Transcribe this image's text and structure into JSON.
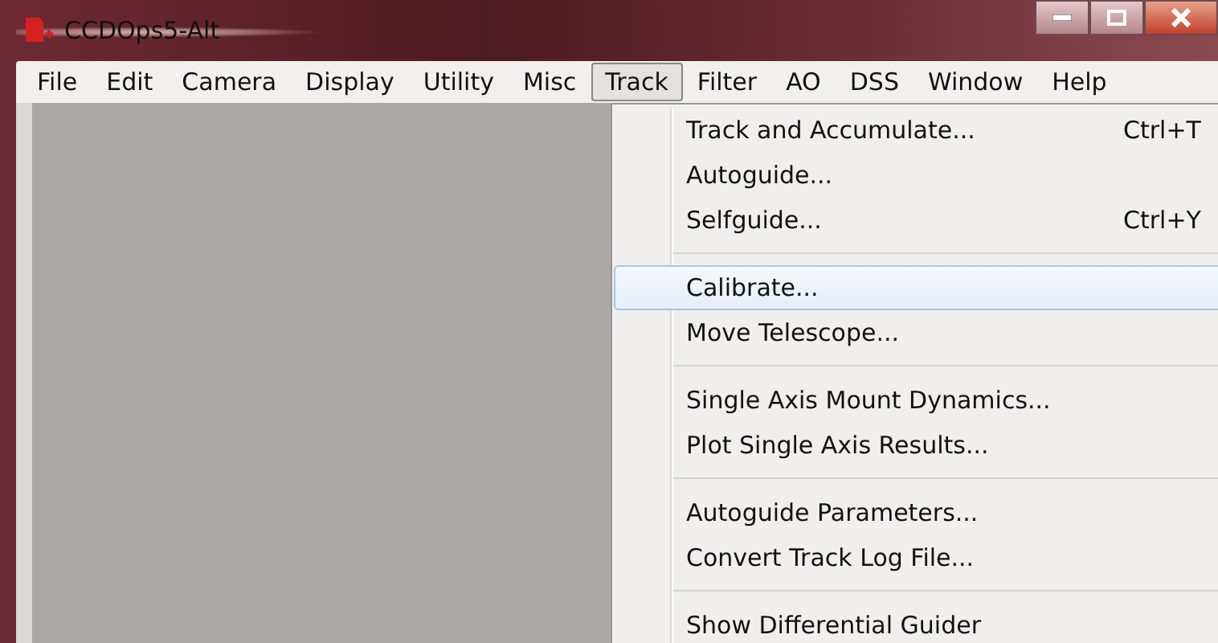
{
  "window": {
    "title": "CCDOps5-Alt"
  },
  "menu_bar": [
    {
      "label": "File",
      "selected": false
    },
    {
      "label": "Edit",
      "selected": false
    },
    {
      "label": "Camera",
      "selected": false
    },
    {
      "label": "Display",
      "selected": false
    },
    {
      "label": "Utility",
      "selected": false
    },
    {
      "label": "Misc",
      "selected": false
    },
    {
      "label": "Track",
      "selected": true
    },
    {
      "label": "Filter",
      "selected": false
    },
    {
      "label": "AO",
      "selected": false
    },
    {
      "label": "DSS",
      "selected": false
    },
    {
      "label": "Window",
      "selected": false
    },
    {
      "label": "Help",
      "selected": false
    }
  ],
  "menu": {
    "items": [
      {
        "kind": "item",
        "label": "Track and Accumulate...",
        "shortcut": "Ctrl+T",
        "selected": false
      },
      {
        "kind": "item",
        "label": "Autoguide...",
        "selected": false
      },
      {
        "kind": "item",
        "label": "Selfguide...",
        "shortcut": "Ctrl+Y",
        "selected": false
      },
      {
        "kind": "separator"
      },
      {
        "kind": "item",
        "label": "Calibrate...",
        "selected": true
      },
      {
        "kind": "item",
        "label": "Move Telescope...",
        "selected": false
      },
      {
        "kind": "separator"
      },
      {
        "kind": "item",
        "label": "Single Axis Mount Dynamics...",
        "selected": false
      },
      {
        "kind": "item",
        "label": "Plot Single Axis Results...",
        "selected": false
      },
      {
        "kind": "separator"
      },
      {
        "kind": "item",
        "label": "Autoguide Parameters...",
        "selected": false
      },
      {
        "kind": "item",
        "label": "Convert Track Log File...",
        "selected": false
      },
      {
        "kind": "separator"
      },
      {
        "kind": "item",
        "label": "Show Differential Guider",
        "selected": false
      }
    ]
  }
}
